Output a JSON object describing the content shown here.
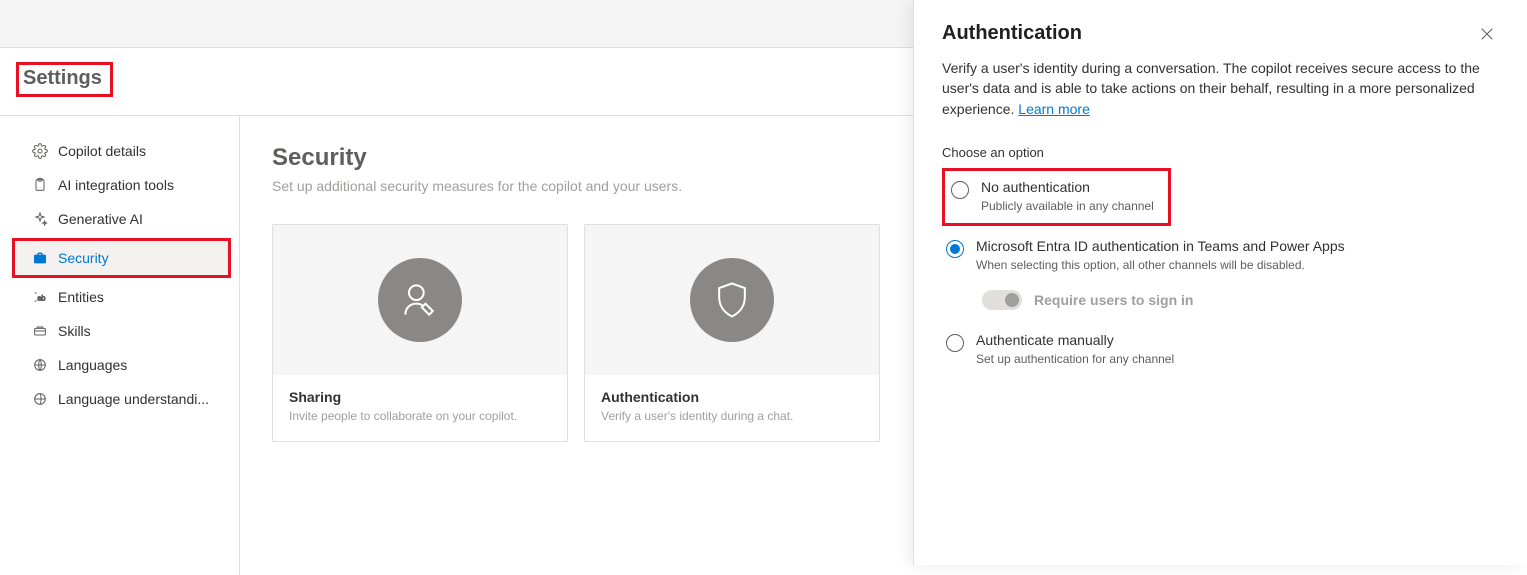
{
  "header": {
    "title": "Settings"
  },
  "sidebar": {
    "items": [
      {
        "label": "Copilot details"
      },
      {
        "label": "AI integration tools"
      },
      {
        "label": "Generative AI"
      },
      {
        "label": "Security"
      },
      {
        "label": "Entities"
      },
      {
        "label": "Skills"
      },
      {
        "label": "Languages"
      },
      {
        "label": "Language understandi..."
      }
    ]
  },
  "main": {
    "title": "Security",
    "subtitle": "Set up additional security measures for the copilot and your users.",
    "cards": [
      {
        "title": "Sharing",
        "desc": "Invite people to collaborate on your copilot."
      },
      {
        "title": "Authentication",
        "desc": "Verify a user's identity during a chat."
      }
    ]
  },
  "panel": {
    "title": "Authentication",
    "desc": "Verify a user's identity during a conversation. The copilot receives secure access to the user's data and is able to take actions on their behalf, resulting in a more personalized experience.",
    "learn_more": "Learn more",
    "choose_label": "Choose an option",
    "options": [
      {
        "title": "No authentication",
        "sub": "Publicly available in any channel",
        "selected": false
      },
      {
        "title": "Microsoft Entra ID authentication in Teams and Power Apps",
        "sub": "When selecting this option, all other channels will be disabled.",
        "selected": true
      },
      {
        "title": "Authenticate manually",
        "sub": "Set up authentication for any channel",
        "selected": false
      }
    ],
    "toggle_label": "Require users to sign in"
  }
}
